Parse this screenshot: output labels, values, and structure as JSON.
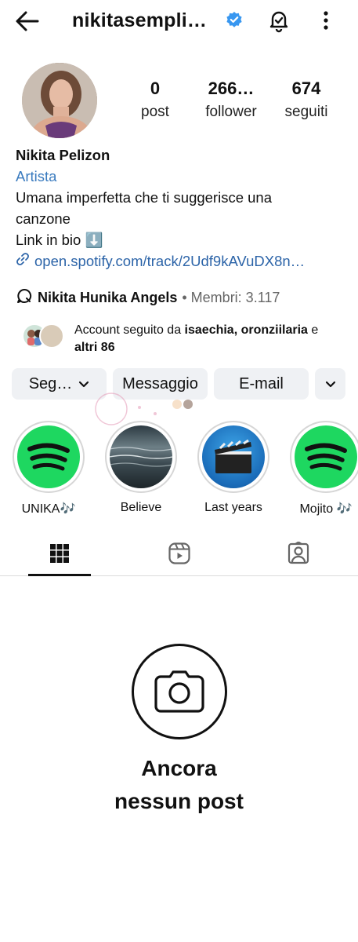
{
  "header": {
    "username": "nikitasempli…",
    "verified": true,
    "icons": [
      "back-arrow-icon",
      "verified-badge-icon",
      "notification-bell-icon",
      "more-options-icon"
    ]
  },
  "stats": {
    "posts": {
      "value": "0",
      "label": "post"
    },
    "followers": {
      "value": "266…",
      "label": "follower"
    },
    "following": {
      "value": "674",
      "label": "seguiti"
    }
  },
  "bio": {
    "name": "Nikita Pelizon",
    "category": "Artista",
    "line1": "Umana imperfetta che ti suggerisce una",
    "line2": "canzone",
    "line3": "Link in bio ⬇️",
    "link": "open.spotify.com/track/2Udf9kAVuDX8n…"
  },
  "channel": {
    "name": "Nikita Hunika Angels",
    "meta": "• Membri: 3.117"
  },
  "followed_by": {
    "prefix": "Account seguito da ",
    "names": "isaechia, oronziilaria",
    "suffix1": " e",
    "others": "altri 86"
  },
  "buttons": {
    "follow": "Seg…",
    "message": "Messaggio",
    "email": "E-mail"
  },
  "highlights": [
    {
      "label": "UNIKA🎶",
      "kind": "spotify"
    },
    {
      "label": "Believe",
      "kind": "water"
    },
    {
      "label": "Last years",
      "kind": "clapper"
    },
    {
      "label": "Mojito 🎶",
      "kind": "spotify"
    }
  ],
  "tabs": [
    "grid-icon",
    "reels-icon",
    "tagged-icon"
  ],
  "empty": {
    "line1": "Ancora",
    "line2": "nessun post"
  },
  "colors": {
    "link": "#2c64a8",
    "category": "#3a7bbf",
    "verified": "#3897f0",
    "spotify": "#1ed760",
    "button_bg": "#eff1f4"
  }
}
